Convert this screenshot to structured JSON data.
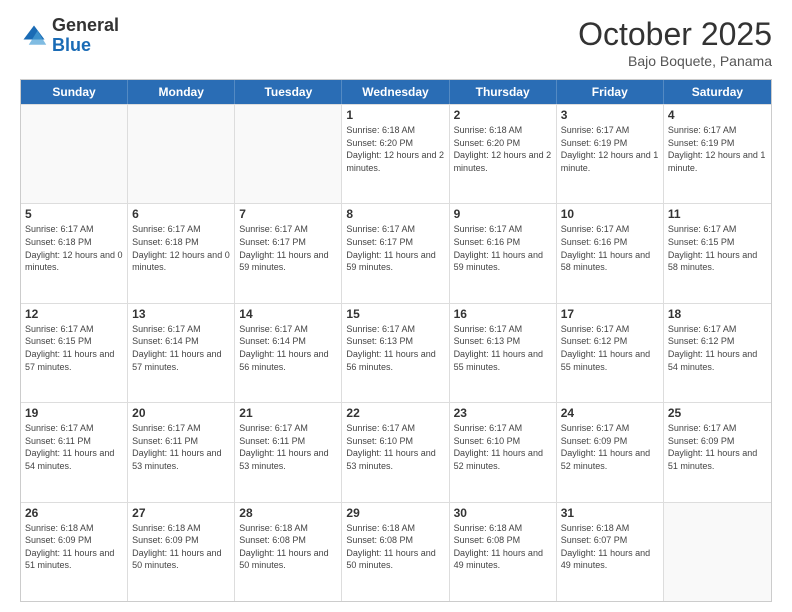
{
  "logo": {
    "general": "General",
    "blue": "Blue"
  },
  "title": "October 2025",
  "subtitle": "Bajo Boquete, Panama",
  "header_days": [
    "Sunday",
    "Monday",
    "Tuesday",
    "Wednesday",
    "Thursday",
    "Friday",
    "Saturday"
  ],
  "weeks": [
    [
      {
        "day": "",
        "info": ""
      },
      {
        "day": "",
        "info": ""
      },
      {
        "day": "",
        "info": ""
      },
      {
        "day": "1",
        "info": "Sunrise: 6:18 AM\nSunset: 6:20 PM\nDaylight: 12 hours and 2 minutes."
      },
      {
        "day": "2",
        "info": "Sunrise: 6:18 AM\nSunset: 6:20 PM\nDaylight: 12 hours and 2 minutes."
      },
      {
        "day": "3",
        "info": "Sunrise: 6:17 AM\nSunset: 6:19 PM\nDaylight: 12 hours and 1 minute."
      },
      {
        "day": "4",
        "info": "Sunrise: 6:17 AM\nSunset: 6:19 PM\nDaylight: 12 hours and 1 minute."
      }
    ],
    [
      {
        "day": "5",
        "info": "Sunrise: 6:17 AM\nSunset: 6:18 PM\nDaylight: 12 hours and 0 minutes."
      },
      {
        "day": "6",
        "info": "Sunrise: 6:17 AM\nSunset: 6:18 PM\nDaylight: 12 hours and 0 minutes."
      },
      {
        "day": "7",
        "info": "Sunrise: 6:17 AM\nSunset: 6:17 PM\nDaylight: 11 hours and 59 minutes."
      },
      {
        "day": "8",
        "info": "Sunrise: 6:17 AM\nSunset: 6:17 PM\nDaylight: 11 hours and 59 minutes."
      },
      {
        "day": "9",
        "info": "Sunrise: 6:17 AM\nSunset: 6:16 PM\nDaylight: 11 hours and 59 minutes."
      },
      {
        "day": "10",
        "info": "Sunrise: 6:17 AM\nSunset: 6:16 PM\nDaylight: 11 hours and 58 minutes."
      },
      {
        "day": "11",
        "info": "Sunrise: 6:17 AM\nSunset: 6:15 PM\nDaylight: 11 hours and 58 minutes."
      }
    ],
    [
      {
        "day": "12",
        "info": "Sunrise: 6:17 AM\nSunset: 6:15 PM\nDaylight: 11 hours and 57 minutes."
      },
      {
        "day": "13",
        "info": "Sunrise: 6:17 AM\nSunset: 6:14 PM\nDaylight: 11 hours and 57 minutes."
      },
      {
        "day": "14",
        "info": "Sunrise: 6:17 AM\nSunset: 6:14 PM\nDaylight: 11 hours and 56 minutes."
      },
      {
        "day": "15",
        "info": "Sunrise: 6:17 AM\nSunset: 6:13 PM\nDaylight: 11 hours and 56 minutes."
      },
      {
        "day": "16",
        "info": "Sunrise: 6:17 AM\nSunset: 6:13 PM\nDaylight: 11 hours and 55 minutes."
      },
      {
        "day": "17",
        "info": "Sunrise: 6:17 AM\nSunset: 6:12 PM\nDaylight: 11 hours and 55 minutes."
      },
      {
        "day": "18",
        "info": "Sunrise: 6:17 AM\nSunset: 6:12 PM\nDaylight: 11 hours and 54 minutes."
      }
    ],
    [
      {
        "day": "19",
        "info": "Sunrise: 6:17 AM\nSunset: 6:11 PM\nDaylight: 11 hours and 54 minutes."
      },
      {
        "day": "20",
        "info": "Sunrise: 6:17 AM\nSunset: 6:11 PM\nDaylight: 11 hours and 53 minutes."
      },
      {
        "day": "21",
        "info": "Sunrise: 6:17 AM\nSunset: 6:11 PM\nDaylight: 11 hours and 53 minutes."
      },
      {
        "day": "22",
        "info": "Sunrise: 6:17 AM\nSunset: 6:10 PM\nDaylight: 11 hours and 53 minutes."
      },
      {
        "day": "23",
        "info": "Sunrise: 6:17 AM\nSunset: 6:10 PM\nDaylight: 11 hours and 52 minutes."
      },
      {
        "day": "24",
        "info": "Sunrise: 6:17 AM\nSunset: 6:09 PM\nDaylight: 11 hours and 52 minutes."
      },
      {
        "day": "25",
        "info": "Sunrise: 6:17 AM\nSunset: 6:09 PM\nDaylight: 11 hours and 51 minutes."
      }
    ],
    [
      {
        "day": "26",
        "info": "Sunrise: 6:18 AM\nSunset: 6:09 PM\nDaylight: 11 hours and 51 minutes."
      },
      {
        "day": "27",
        "info": "Sunrise: 6:18 AM\nSunset: 6:09 PM\nDaylight: 11 hours and 50 minutes."
      },
      {
        "day": "28",
        "info": "Sunrise: 6:18 AM\nSunset: 6:08 PM\nDaylight: 11 hours and 50 minutes."
      },
      {
        "day": "29",
        "info": "Sunrise: 6:18 AM\nSunset: 6:08 PM\nDaylight: 11 hours and 50 minutes."
      },
      {
        "day": "30",
        "info": "Sunrise: 6:18 AM\nSunset: 6:08 PM\nDaylight: 11 hours and 49 minutes."
      },
      {
        "day": "31",
        "info": "Sunrise: 6:18 AM\nSunset: 6:07 PM\nDaylight: 11 hours and 49 minutes."
      },
      {
        "day": "",
        "info": ""
      }
    ]
  ]
}
